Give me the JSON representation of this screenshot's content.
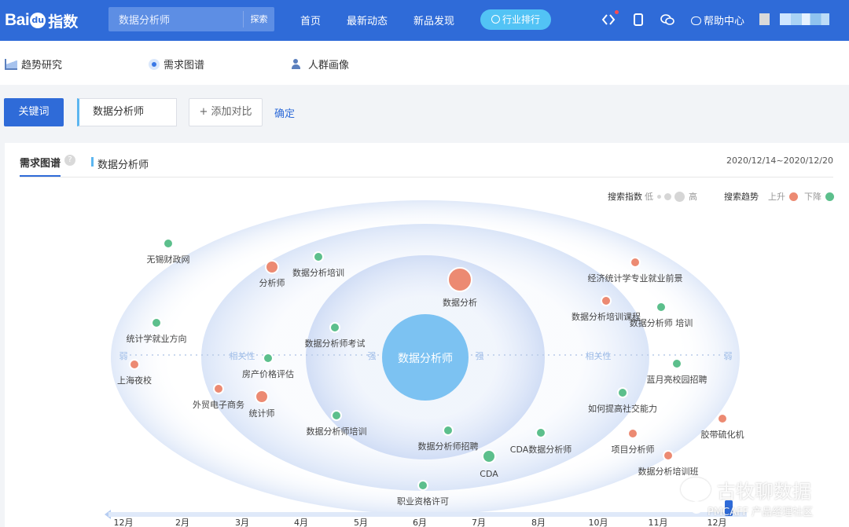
{
  "header": {
    "logo_bai": "Bai",
    "logo_du": "du",
    "logo_zhishu": "指数",
    "search_value": "数据分析师",
    "search_button": "探索",
    "nav": [
      "首页",
      "最新动态",
      "新品发现"
    ],
    "highlight_nav": "行业排行",
    "help": "帮助中心",
    "colors": {
      "bar": "#2f6bd8",
      "pill": "#52c3f5"
    }
  },
  "subnav": {
    "tabs": [
      "趋势研究",
      "需求图谱",
      "人群画像"
    ],
    "active": "需求图谱"
  },
  "keyword_bar": {
    "keyword_button": "关键词",
    "keyword": "数据分析师",
    "add_compare": "+ 添加对比",
    "confirm": "确定"
  },
  "panel": {
    "tab": "需求图谱",
    "help_mark": "?",
    "keyword_tag": "数据分析师",
    "date_range": "2020/12/14~2020/12/20",
    "legend": {
      "search_index": "搜索指数",
      "low": "低",
      "high": "高",
      "trend": "搜索趋势",
      "rise": "上升",
      "fall": "下降",
      "rise_color": "#ec8a72",
      "fall_color": "#5cbf8c"
    },
    "axis": {
      "weak": "弱",
      "relevance": "相关性",
      "strong": "强"
    },
    "center": "数据分析师",
    "nodes": [
      {
        "label": "无锡财政网",
        "trend": "fall",
        "size": 1
      },
      {
        "label": "分析师",
        "trend": "rise",
        "size": 2
      },
      {
        "label": "数据分析培训",
        "trend": "fall",
        "size": 1
      },
      {
        "label": "数据分析",
        "trend": "rise",
        "size": 4
      },
      {
        "label": "经济统计学专业就业前景",
        "trend": "rise",
        "size": 1
      },
      {
        "label": "数据分析培训课程",
        "trend": "rise",
        "size": 1
      },
      {
        "label": "数据分析师 培训",
        "trend": "fall",
        "size": 1
      },
      {
        "label": "统计学就业方向",
        "trend": "fall",
        "size": 1
      },
      {
        "label": "数据分析师考试",
        "trend": "fall",
        "size": 1
      },
      {
        "label": "上海夜校",
        "trend": "rise",
        "size": 1
      },
      {
        "label": "房产价格评估",
        "trend": "fall",
        "size": 1
      },
      {
        "label": "蓝月亮校园招聘",
        "trend": "fall",
        "size": 1
      },
      {
        "label": "外贸电子商务",
        "trend": "rise",
        "size": 1
      },
      {
        "label": "统计师",
        "trend": "rise",
        "size": 2
      },
      {
        "label": "如何提高社交能力",
        "trend": "fall",
        "size": 1
      },
      {
        "label": "胶带硫化机",
        "trend": "rise",
        "size": 1
      },
      {
        "label": "数据分析师培训",
        "trend": "fall",
        "size": 1
      },
      {
        "label": "数据分析师招聘",
        "trend": "fall",
        "size": 1
      },
      {
        "label": "CDA数据分析师",
        "trend": "fall",
        "size": 1
      },
      {
        "label": "项目分析师",
        "trend": "rise",
        "size": 1
      },
      {
        "label": "CDA",
        "trend": "fall",
        "size": 2
      },
      {
        "label": "数据分析培训班",
        "trend": "rise",
        "size": 1
      },
      {
        "label": "职业资格许可",
        "trend": "fall",
        "size": 1
      }
    ],
    "timeline_months": [
      "12月",
      "2月",
      "3月",
      "4月",
      "5月",
      "6月",
      "7月",
      "8月",
      "10月",
      "11月",
      "12月"
    ]
  },
  "watermark": {
    "line1": "古牧聊数据",
    "line2": "PMCAFF 产品经理社区"
  }
}
